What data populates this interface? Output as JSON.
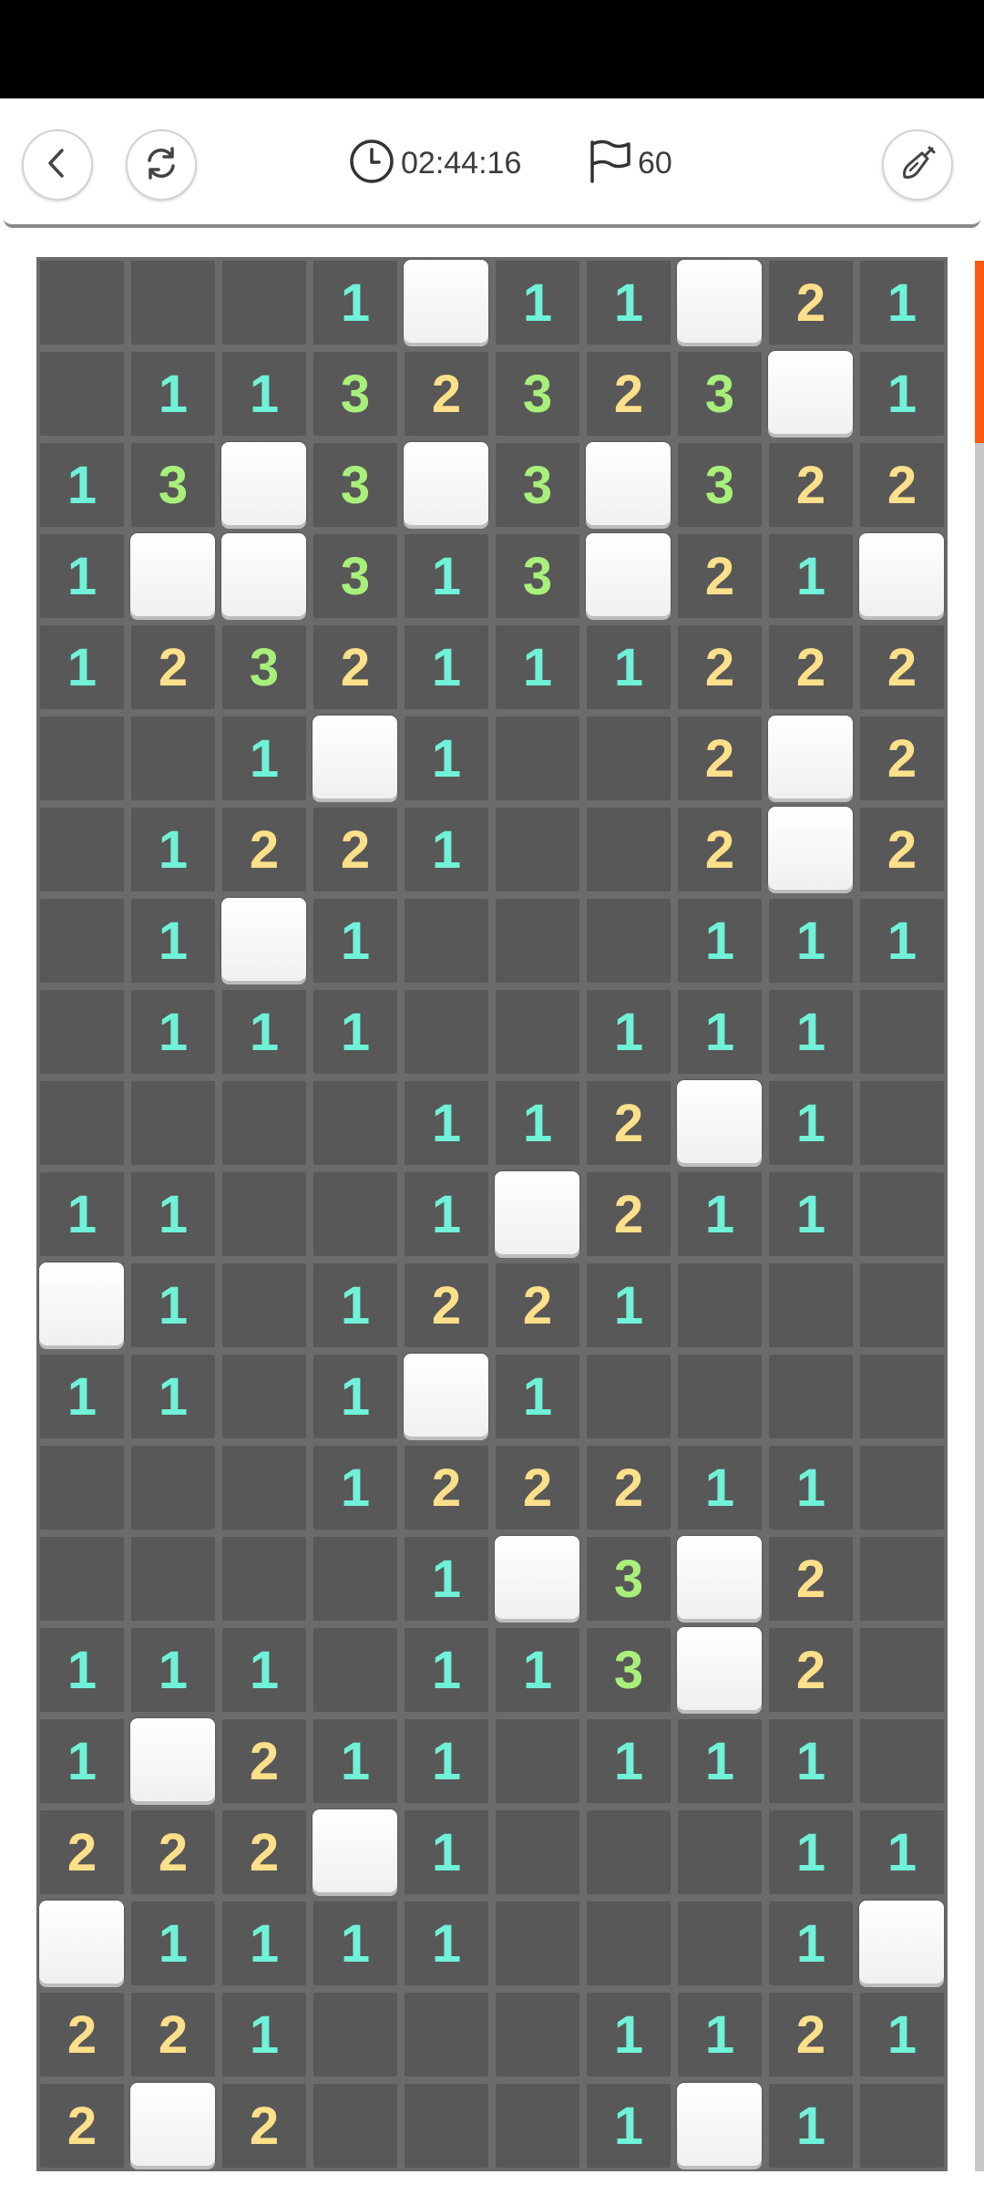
{
  "status_bar": {},
  "toolbar": {
    "timer": "02:44:16",
    "flags": "60",
    "icons": {
      "back": "chevron-left-icon",
      "refresh": "refresh-icon",
      "timer": "clock-icon",
      "flags": "flag-icon",
      "hint": "shovel-icon"
    }
  },
  "colors": {
    "board": "#6b6b6b",
    "open_cell": "#585858",
    "closed_cell": "#ffffff",
    "number_1": "#6ff2d8",
    "number_2": "#ffe08a",
    "number_3": "#a8f07a",
    "scroll_thumb": "#ff5a12"
  },
  "board": {
    "columns": 10,
    "rows": [
      [
        "",
        "",
        "",
        "1",
        "#",
        "1",
        "1",
        "#",
        "2",
        "1"
      ],
      [
        "",
        "1",
        "1",
        "3",
        "2",
        "3",
        "2",
        "3",
        "#",
        "1"
      ],
      [
        "1",
        "3",
        "#",
        "3",
        "#",
        "3",
        "#",
        "3",
        "2",
        "2"
      ],
      [
        "1",
        "#",
        "#",
        "3",
        "1",
        "3",
        "#",
        "2",
        "1",
        "#"
      ],
      [
        "1",
        "2",
        "3",
        "2",
        "1",
        "1",
        "1",
        "2",
        "2",
        "2"
      ],
      [
        "",
        "",
        "1",
        "#",
        "1",
        "",
        "",
        "2",
        "#",
        "2"
      ],
      [
        "",
        "1",
        "2",
        "2",
        "1",
        "",
        "",
        "2",
        "#",
        "2"
      ],
      [
        "",
        "1",
        "#",
        "1",
        "",
        "",
        "",
        "1",
        "1",
        "1"
      ],
      [
        "",
        "1",
        "1",
        "1",
        "",
        "",
        "1",
        "1",
        "1",
        ""
      ],
      [
        "",
        "",
        "",
        "",
        "1",
        "1",
        "2",
        "#",
        "1",
        ""
      ],
      [
        "1",
        "1",
        "",
        "",
        "1",
        "#",
        "2",
        "1",
        "1",
        ""
      ],
      [
        "#",
        "1",
        "",
        "1",
        "2",
        "2",
        "1",
        "",
        "",
        ""
      ],
      [
        "1",
        "1",
        "",
        "1",
        "#",
        "1",
        "",
        "",
        "",
        ""
      ],
      [
        "",
        "",
        "",
        "1",
        "2",
        "2",
        "2",
        "1",
        "1",
        ""
      ],
      [
        "",
        "",
        "",
        "",
        "1",
        "#",
        "3",
        "#",
        "2",
        ""
      ],
      [
        "1",
        "1",
        "1",
        "",
        "1",
        "1",
        "3",
        "#",
        "2",
        ""
      ],
      [
        "1",
        "#",
        "2",
        "1",
        "1",
        "",
        "1",
        "1",
        "1",
        ""
      ],
      [
        "2",
        "2",
        "2",
        "#",
        "1",
        "",
        "",
        "",
        "1",
        "1"
      ],
      [
        "#",
        "1",
        "1",
        "1",
        "1",
        "",
        "",
        "",
        "1",
        "#"
      ],
      [
        "2",
        "2",
        "1",
        "",
        "",
        "",
        "1",
        "1",
        "2",
        "1"
      ],
      [
        "2",
        "#",
        "2",
        "",
        "",
        "",
        "1",
        "#",
        "1",
        ""
      ]
    ]
  }
}
